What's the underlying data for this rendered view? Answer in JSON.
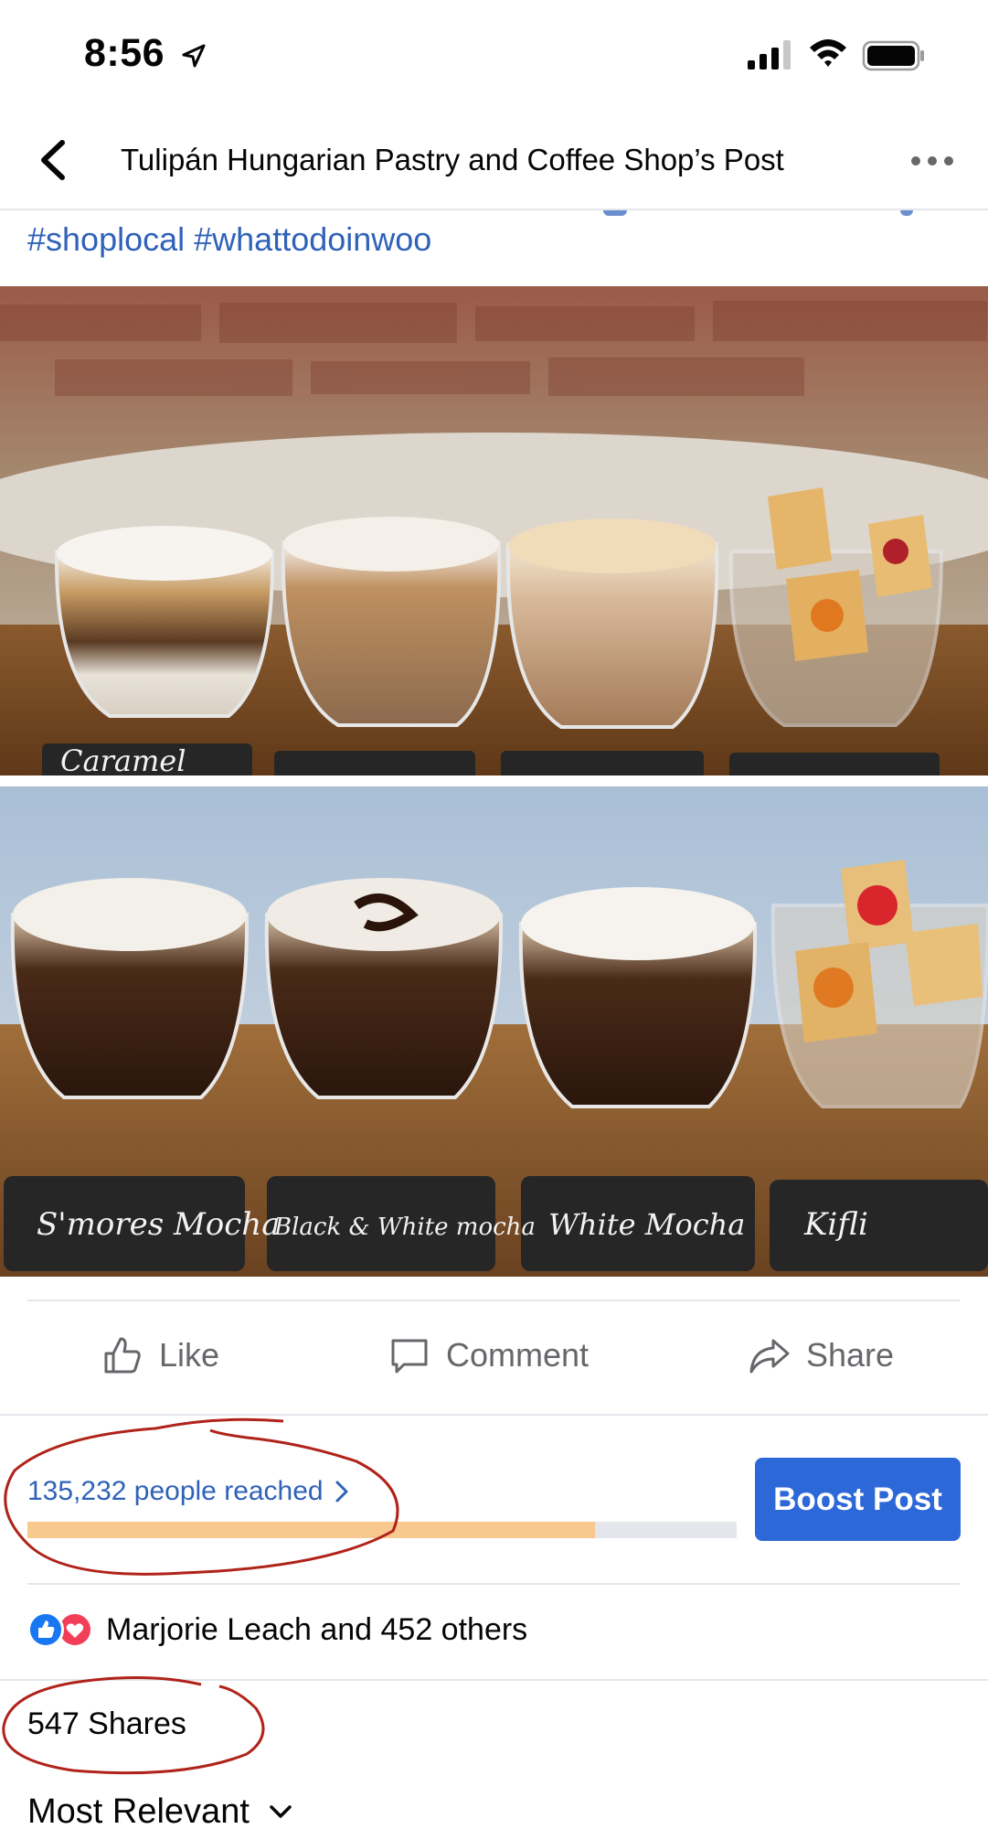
{
  "status_bar": {
    "time": "8:56"
  },
  "header": {
    "title": "Tulipán Hungarian Pastry and Coffee Shop’s Post"
  },
  "post": {
    "hashtags": "#shoplocal #whattodoinwoo",
    "photo_1_labels": [
      "Caramel"
    ],
    "photo_2_labels": [
      "S'mores Mocha",
      "Black & White mocha",
      "White Mocha",
      "Kifli"
    ]
  },
  "actions": {
    "like": "Like",
    "comment": "Comment",
    "share": "Share"
  },
  "reach": {
    "text": "135,232 people reached",
    "progress_fraction": 0.8
  },
  "boost_label": "Boost Post",
  "reactions_text": "Marjorie Leach and 452 others",
  "shares_text": "547 Shares",
  "sort_label": "Most Relevant",
  "colors": {
    "link": "#2f62b8",
    "boost": "#2d68d8",
    "reach_fill": "#f7c98f",
    "annotation": "#b0231a"
  }
}
